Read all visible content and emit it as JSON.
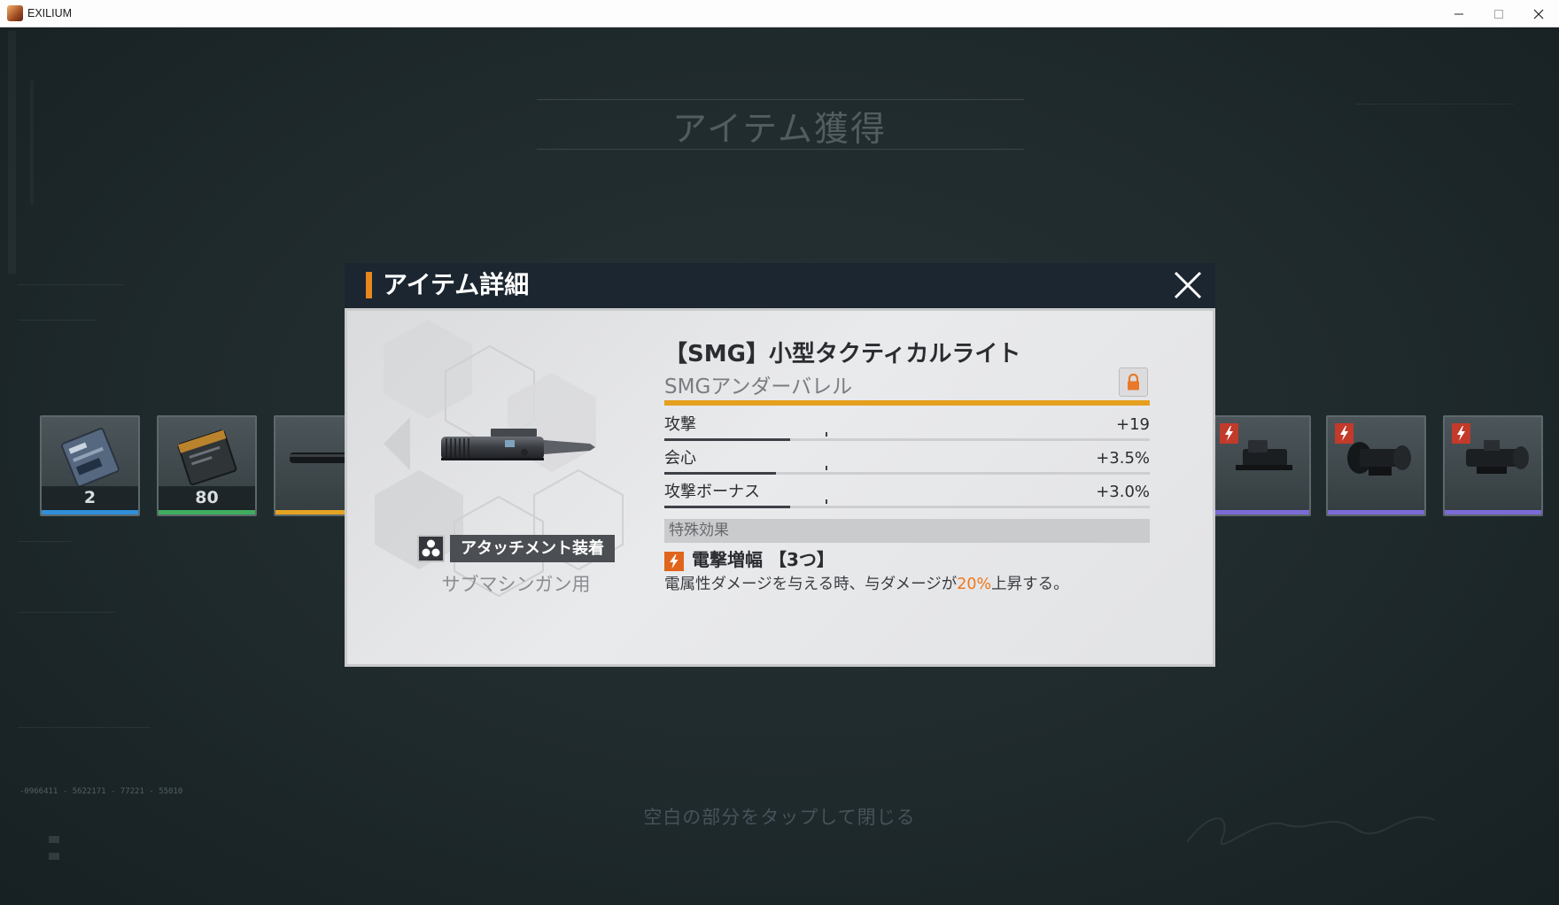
{
  "window": {
    "title": "EXILIUM",
    "app_icon": "exilium-app-icon",
    "controls": {
      "minimize_icon": "minimize-icon",
      "maximize_icon": "maximize-icon",
      "close_icon": "close-icon"
    }
  },
  "screen": {
    "title": "アイテム獲得",
    "hint": "空白の部分をタップして閉じる",
    "serial_text": "-0966411 - 5622171 - 77221 - 55010"
  },
  "rewards": [
    {
      "count": "2",
      "rarity_color": "#2f8fd8",
      "icon": "item-box-icon"
    },
    {
      "count": "80",
      "rarity_color": "#3fae5e",
      "icon": "material-crate-icon"
    },
    {
      "rarity_color": "#e5a323",
      "icon": "barrel-attachment-icon"
    },
    {
      "rarity_color": "#7b6bd6",
      "icon": "red-dot-sight-icon",
      "badge": "lightning-icon"
    },
    {
      "rarity_color": "#7b6bd6",
      "icon": "scope-icon",
      "badge": "lightning-icon"
    },
    {
      "rarity_color": "#7b6bd6",
      "icon": "scope-icon",
      "badge": "lightning-icon"
    }
  ],
  "modal": {
    "header_title": "アイテム詳細",
    "close_icon": "close-icon",
    "item_icon": "tactical-light-icon",
    "item_name": "【SMG】小型タクティカルライト",
    "item_type": "SMGアンダーバレル",
    "lock_icon": "lock-icon",
    "badge_icon": "attachment-icon",
    "badge_label": "アタッチメント装着",
    "usage": "サブマシンガン用",
    "stats": [
      {
        "label": "攻撃",
        "value": "+19",
        "fill": 0.26
      },
      {
        "label": "会心",
        "value": "+3.5%",
        "fill": 0.23
      },
      {
        "label": "攻撃ボーナス",
        "value": "+3.0%",
        "fill": 0.26
      }
    ],
    "special_header": "特殊効果",
    "effect_icon": "lightning-icon",
    "effect_name": "電撃増幅 【3つ】",
    "effect_desc_pre": "電属性ダメージを与える時、与ダメージが",
    "effect_highlight": "20%",
    "effect_desc_post": "上昇する。"
  },
  "colors": {
    "accent": "#e8871e",
    "rarity_bar": "#e5a020",
    "highlight": "#f0781a"
  }
}
